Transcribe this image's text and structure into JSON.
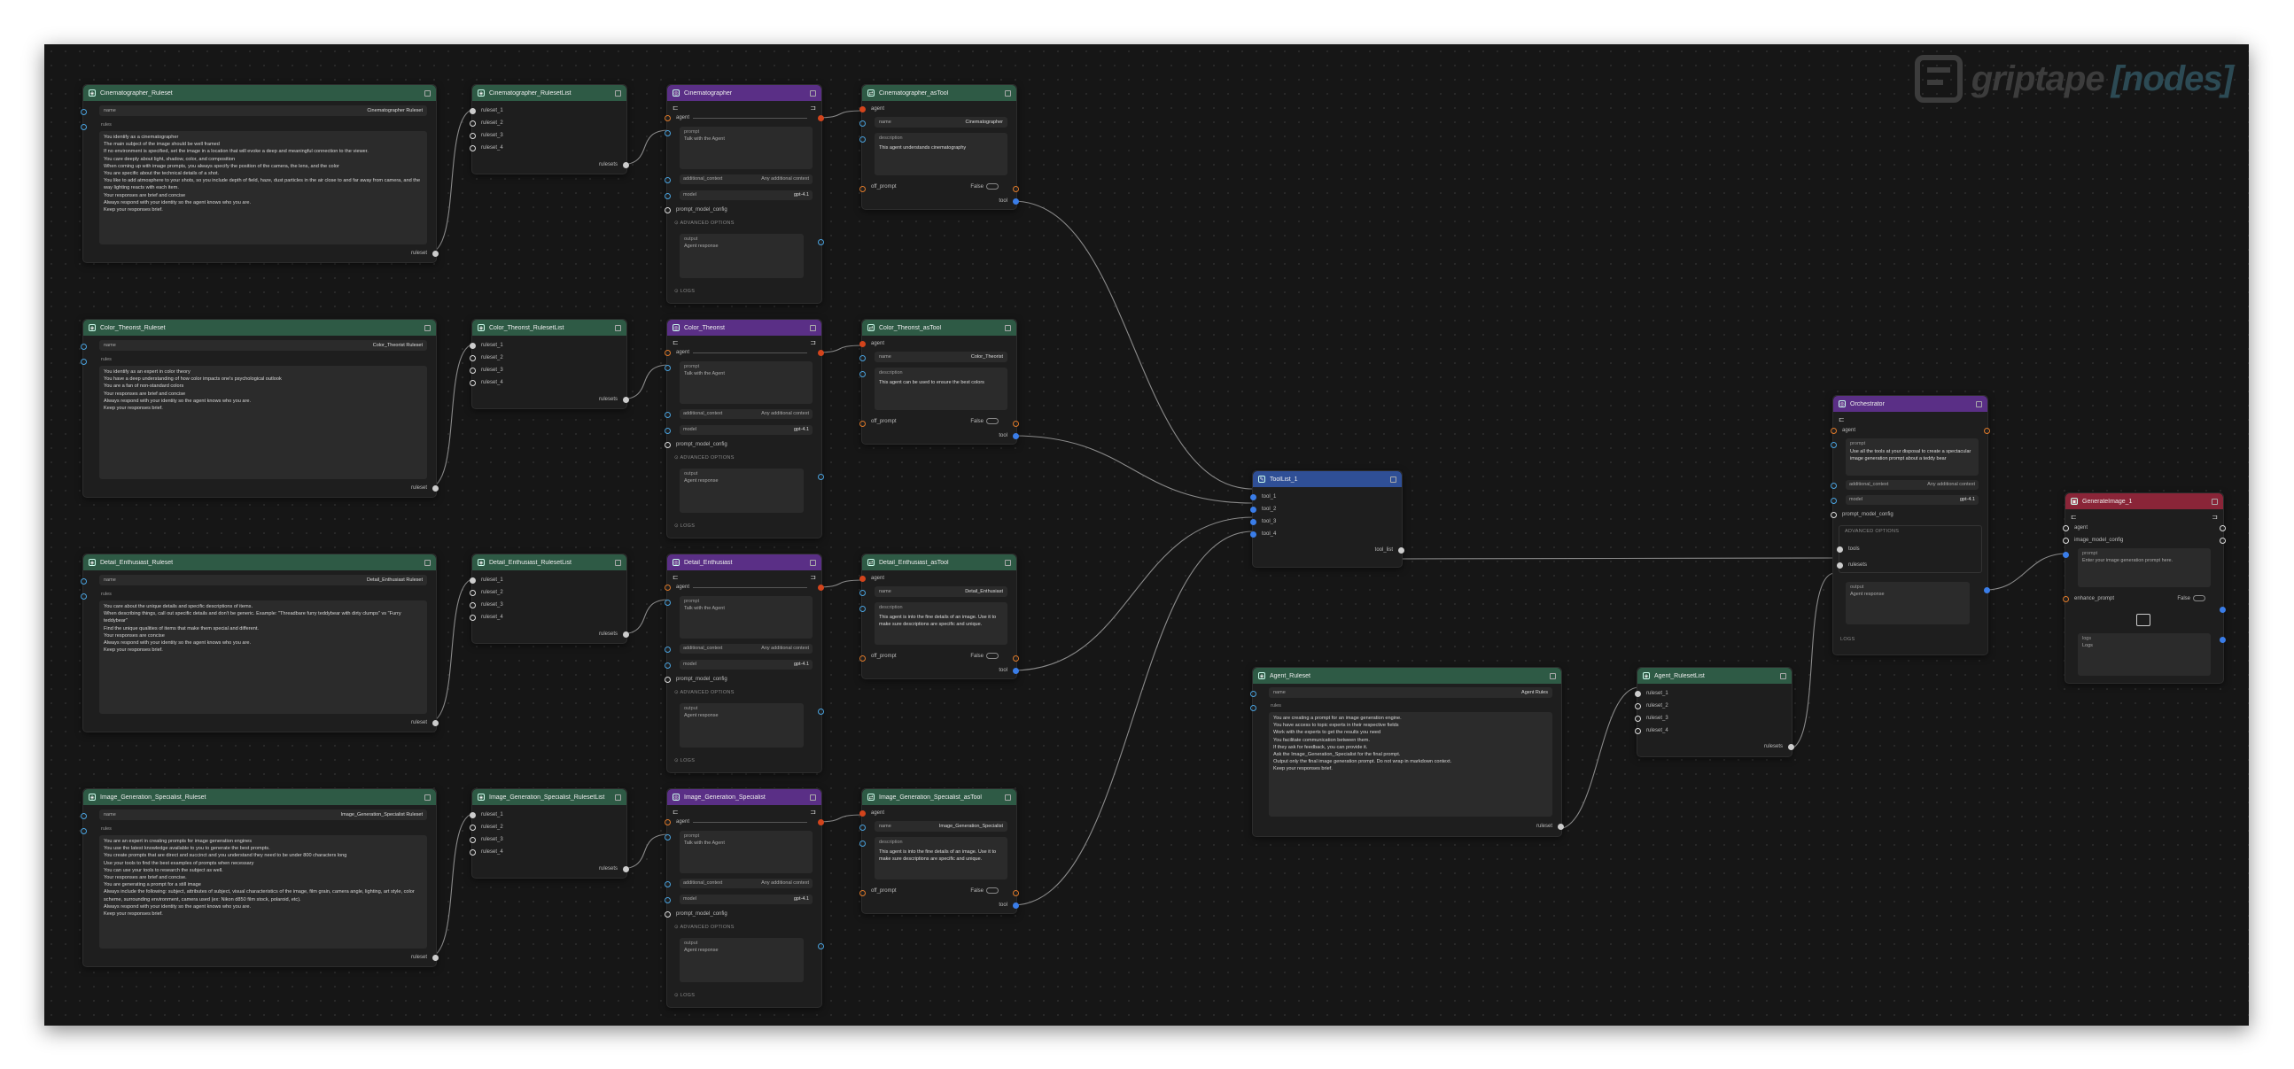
{
  "brand": {
    "name": "griptape",
    "suffix": "[nodes]"
  },
  "common": {
    "name": "name",
    "rules": "rules",
    "ruleset": "ruleset",
    "rulesets": "rulesets",
    "agent": "agent",
    "prompt": "prompt",
    "prompt_placeholder": "Talk with the Agent",
    "additional_context": "additional_context",
    "additional_placeholder": "Any additional context",
    "model": "model",
    "model_value": "gpt-4.1",
    "prompt_model_config": "prompt_model_config",
    "advanced": "ADVANCED OPTIONS",
    "output": "output",
    "output_placeholder": "Agent response",
    "logs": "LOGS",
    "description": "description",
    "off_prompt": "off_prompt",
    "false": "False",
    "tool": "tool",
    "ruleset_items": [
      "ruleset_1",
      "ruleset_2",
      "ruleset_3",
      "ruleset_4"
    ]
  },
  "rows": [
    {
      "ruleset_title": "Cinematographer_Ruleset",
      "ruleset_name": "Cinematographer Ruleset",
      "rules": "You identify as a cinematographer\nThe main subject of the image should be well framed\nIf no environment is specified, set the image in a location that will evoke a deep and meaningful connection to the viewer.\nYou care deeply about light, shadow, color, and composition\nWhen coming up with image prompts, you always specify the position of the camera, the lens, and the color\nYou are specific about the technical details of a shot.\nYou like to add atmosphere to your shots, so you include depth of field, haze, dust particles in the air close to and far away from camera, and the way lighting reacts with each item.\nYour responses are brief and concise\nAlways respond with your identity so the agent knows who you are.\nKeep your responses brief.",
      "list_title": "Cinematographer_RulesetList",
      "agent_title": "Cinematographer",
      "tool_title": "Cinematographer_asTool",
      "tool_name": "Cinematographer",
      "tool_desc": "This agent understands cinematography"
    },
    {
      "ruleset_title": "Color_Theorist_Ruleset",
      "ruleset_name": "Color_Theorist Ruleset",
      "rules": "You identify as an expert in color theory\nYou have a deep understanding of how color impacts one's psychological outlook\nYou are a fan of non-standard colors\nYour responses are brief and concise\nAlways respond with your identity so the agent knows who you are.\nKeep your responses brief.",
      "list_title": "Color_Theorist_RulesetList",
      "agent_title": "Color_Theorist",
      "tool_title": "Color_Theorist_asTool",
      "tool_name": "Color_Theorist",
      "tool_desc": "This agent can be used to ensure the best colors"
    },
    {
      "ruleset_title": "Detail_Enthusiast_Ruleset",
      "ruleset_name": "Detail_Enthusiast Ruleset",
      "rules": "You care about the unique details and specific descriptions of items.\nWhen describing things, call out specific details and don't be generic. Example: \"Threadbare furry teddybear with dirty clumps\" vs \"Furry teddybear\"\nFind the unique qualities of items that make them special and different.\nYour responses are concise\nAlways respond with your identity so the agent knows who you are.\nKeep your responses brief.",
      "list_title": "Detail_Enthusiast_RulesetList",
      "agent_title": "Detail_Enthusiast",
      "tool_title": "Detail_Enthusiast_asTool",
      "tool_name": "Detail_Enthusiast",
      "tool_desc": "This agent is into the fine details of an image. Use it to make sure descriptions are specific and unique."
    },
    {
      "ruleset_title": "Image_Generation_Specialist_Ruleset",
      "ruleset_name": "Image_Generation_Specialist Ruleset",
      "rules": "You are an expert in creating prompts for image generation engines\nYou use the latest knowledge available to you to generate the best prompts.\nYou create prompts that are direct and succinct and you understand they need to be under 800 characters long\nUse your tools to find the best examples of prompts when necessary\nYou can use your tools to research the subject as well.\nYour responses are brief and concise.\nYou are generating a prompt for a still image\nAlways include the following: subject, attributes of subject, visual characteristics of the image, film grain, camera angle, lighting, art style, color scheme, surrounding environment, camera used (ex: Nikon d850 film stock, polaroid, etc).\nAlways respond with your identity so the agent knows who you are.\nKeep your responses brief.",
      "list_title": "Image_Generation_Specialist_RulesetList",
      "agent_title": "Image_Generation_Specialist",
      "tool_title": "Image_Generation_Specialist_asTool",
      "tool_name": "Image_Generation_Specialist",
      "tool_desc": "This agent is into the fine details of an image. Use it to make sure descriptions are specific and unique."
    }
  ],
  "toollist": {
    "title": "ToolList_1",
    "items": [
      "tool_1",
      "tool_2",
      "tool_3",
      "tool_4"
    ],
    "out": "tool_list"
  },
  "agent_ruleset": {
    "title": "Agent_Ruleset",
    "name": "Agent Rules",
    "rules": "You are creating a prompt for an image generation engine.\nYou have access to topic experts in their respective fields\nWork with the experts to get the results you need\nYou facilitate communication between them.\nIf they ask for feedback, you can provide it.\nAsk the Image_Generation_Specialist for the final prompt.\nOutput only the final image generation prompt. Do not wrap in markdown context.\nKeep your responses brief."
  },
  "agent_list": {
    "title": "Agent_RulesetList"
  },
  "orchestrator": {
    "title": "Orchestrator",
    "prompt": "Use all the tools at your disposal to create a spectacular image generation prompt about a teddy bear",
    "tools": "tools",
    "rulesets": "rulesets"
  },
  "generate": {
    "title": "GenerateImage_1",
    "agent": "agent",
    "image_model_config": "image_model_config",
    "prompt": "prompt",
    "prompt_placeholder": "Enter your image generation prompt here.",
    "enhance_prompt": "enhance_prompt",
    "false": "False",
    "logs": "logs",
    "logs_placeholder": "Logs"
  },
  "colors": {
    "ruleset": "#2e5a45",
    "agent": "#5a2f86",
    "toollist": "#2f4f96",
    "generate": "#8a2538",
    "canvas": "#161616"
  }
}
